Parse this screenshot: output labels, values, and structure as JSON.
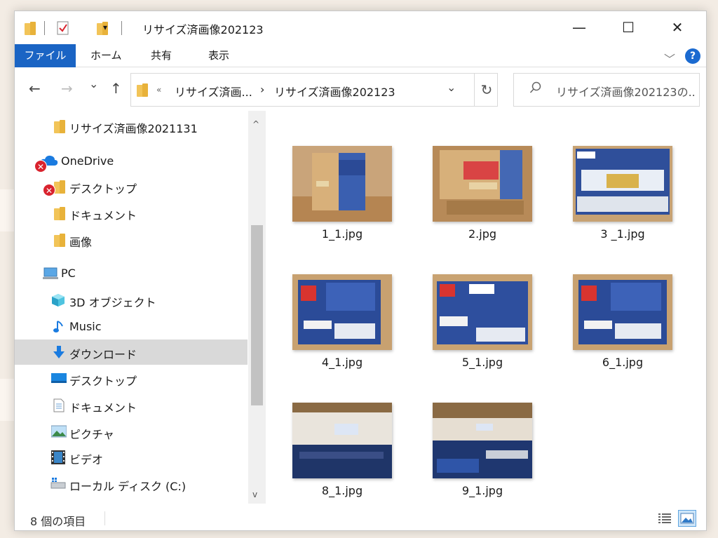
{
  "window": {
    "title": "リサイズ済画像202123",
    "minimize": "—",
    "maximize": "☐",
    "close": "✕"
  },
  "ribbon": {
    "tabs": [
      "ファイル",
      "ホーム",
      "共有",
      "表示"
    ],
    "help": "?",
    "collapse": "﹀"
  },
  "nav": {
    "back": "←",
    "forward": "→",
    "recent": "⌄",
    "up": "↑",
    "breadcrumb_overflow": "«",
    "breadcrumb_parent": "リサイズ済画...",
    "breadcrumb_sep": "›",
    "breadcrumb_current": "リサイズ済画像202123",
    "dropdown": "⌄",
    "refresh": "↻",
    "search_placeholder": "リサイズ済画像202123の...",
    "search_icon": "⚲"
  },
  "sidebar": {
    "items": [
      {
        "label": "リサイズ済画像2021131",
        "icon": "folder-icon"
      },
      {
        "label": "OneDrive",
        "icon": "cloud-icon"
      },
      {
        "label": "デスクトップ",
        "icon": "folder-icon"
      },
      {
        "label": "ドキュメント",
        "icon": "folder-icon"
      },
      {
        "label": "画像",
        "icon": "folder-icon"
      },
      {
        "label": "PC",
        "icon": "pc-icon"
      },
      {
        "label": "3D オブジェクト",
        "icon": "cube-icon"
      },
      {
        "label": "Music",
        "icon": "music-note-icon"
      },
      {
        "label": "ダウンロード",
        "icon": "download-arrow-icon"
      },
      {
        "label": "デスクトップ",
        "icon": "desktop-icon"
      },
      {
        "label": "ドキュメント",
        "icon": "document-icon"
      },
      {
        "label": "ピクチャ",
        "icon": "picture-icon"
      },
      {
        "label": "ビデオ",
        "icon": "film-icon"
      },
      {
        "label": "ローカル ディスク (C:)",
        "icon": "drive-icon"
      }
    ],
    "selected": "ダウンロード",
    "error_badge": "✕"
  },
  "scrollbar": {
    "up": "^",
    "down": "v"
  },
  "files": [
    {
      "name": "1_1.jpg",
      "thumb": "cardboard-box-photo"
    },
    {
      "name": "2.jpg",
      "thumb": "cardboard-box-photo"
    },
    {
      "name": "3 _1.jpg",
      "thumb": "battery-box-photo"
    },
    {
      "name": "4_1.jpg",
      "thumb": "battery-box-photo"
    },
    {
      "name": "5_1.jpg",
      "thumb": "battery-box-photo"
    },
    {
      "name": "6_1.jpg",
      "thumb": "battery-box-photo"
    },
    {
      "name": "8_1.jpg",
      "thumb": "battery-top-photo"
    },
    {
      "name": "9_1.jpg",
      "thumb": "battery-top-photo"
    }
  ],
  "status": {
    "item_count": "8 個の項目"
  },
  "colors": {
    "accent": "#1a64c4",
    "folder": "#f2c458",
    "selected_row": "#d9d9d9",
    "error": "#d9232e"
  }
}
